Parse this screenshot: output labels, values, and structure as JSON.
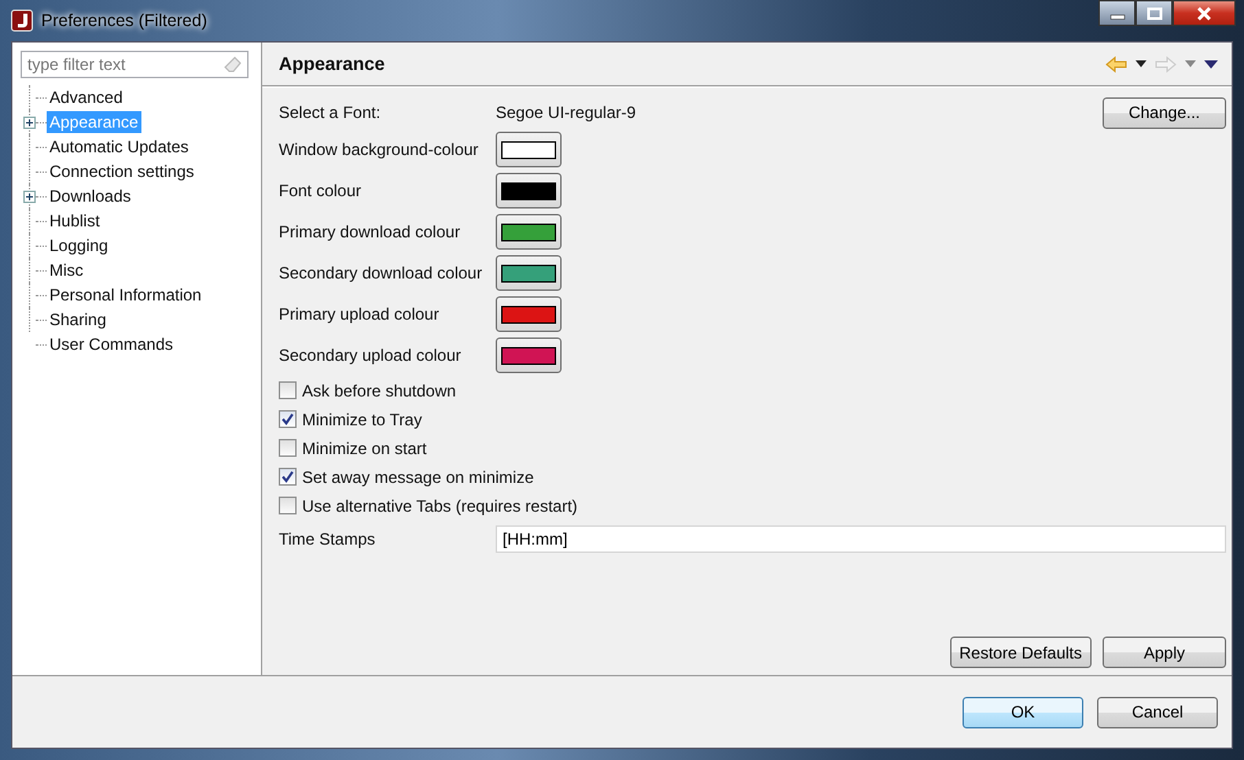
{
  "window": {
    "title": "Preferences (Filtered)"
  },
  "filter": {
    "placeholder": "type filter text"
  },
  "tree": [
    {
      "label": "Advanced",
      "expandable": false,
      "selected": false
    },
    {
      "label": "Appearance",
      "expandable": true,
      "selected": true
    },
    {
      "label": "Automatic Updates",
      "expandable": false,
      "selected": false
    },
    {
      "label": "Connection settings",
      "expandable": false,
      "selected": false
    },
    {
      "label": "Downloads",
      "expandable": true,
      "selected": false
    },
    {
      "label": "Hublist",
      "expandable": false,
      "selected": false
    },
    {
      "label": "Logging",
      "expandable": false,
      "selected": false
    },
    {
      "label": "Misc",
      "expandable": false,
      "selected": false
    },
    {
      "label": "Personal Information",
      "expandable": false,
      "selected": false
    },
    {
      "label": "Sharing",
      "expandable": false,
      "selected": false
    },
    {
      "label": "User Commands",
      "expandable": false,
      "selected": false
    }
  ],
  "page": {
    "title": "Appearance",
    "font": {
      "label": "Select a Font:",
      "value": "Segoe UI-regular-9",
      "button": "Change..."
    },
    "colours": [
      {
        "label": "Window background-colour",
        "color": "#ffffff"
      },
      {
        "label": "Font colour",
        "color": "#000000"
      },
      {
        "label": "Primary download colour",
        "color": "#35a03a"
      },
      {
        "label": "Secondary download colour",
        "color": "#35a07a"
      },
      {
        "label": "Primary upload colour",
        "color": "#dc1414"
      },
      {
        "label": "Secondary upload colour",
        "color": "#d01454"
      }
    ],
    "options": [
      {
        "label": "Ask before shutdown",
        "checked": false
      },
      {
        "label": "Minimize to Tray",
        "checked": true
      },
      {
        "label": "Minimize on start",
        "checked": false
      },
      {
        "label": "Set away message on minimize",
        "checked": true
      },
      {
        "label": "Use alternative Tabs (requires restart)",
        "checked": false
      }
    ],
    "time_stamps": {
      "label": "Time Stamps",
      "value": "[HH:mm]"
    },
    "buttons": [
      "Restore Defaults",
      "Apply"
    ]
  },
  "dialog_buttons": [
    {
      "label": "OK",
      "default": true
    },
    {
      "label": "Cancel",
      "default": false
    }
  ]
}
